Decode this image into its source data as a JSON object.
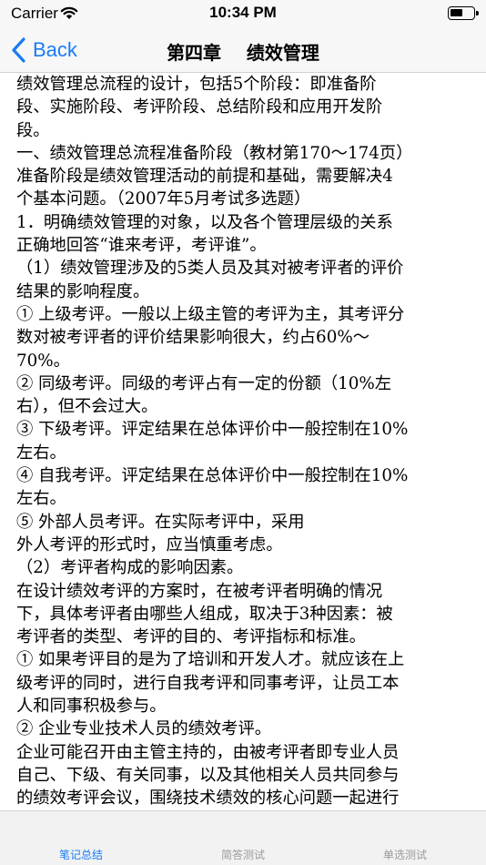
{
  "status_bar": {
    "carrier": "Carrier",
    "time": "10:34 PM"
  },
  "nav": {
    "back_label": "Back",
    "title": "第四章    绩效管理"
  },
  "content": {
    "lines": [
      "绩效管理总流程的设计，包括5个阶段：即准备阶",
      "段、实施阶段、考评阶段、总结阶段和应用开发阶",
      "段。",
      "一、绩效管理总流程准备阶段（教材第170～174页）",
      "准备阶段是绩效管理活动的前提和基础，需要解决4",
      "个基本问题。（2007年5月考试多选题）",
      "1．明确绩效管理的对象，以及各个管理层级的关系",
      "正确地回答“谁来考评，考评谁”。",
      "（1）绩效管理涉及的5类人员及其对被考评者的评价",
      "结果的影响程度。",
      "① 上级考评。一般以上级主管的考评为主，其考评分",
      "数对被考评者的评价结果影响很大，约占60%～",
      "70%。",
      "② 同级考评。同级的考评占有一定的份额（10%左",
      "右），但不会过大。",
      "③ 下级考评。评定结果在总体评价中一般控制在10%",
      "左右。",
      "④ 自我考评。评定结果在总体评价中一般控制在10%",
      "左右。",
      "⑤ 外部人员考评。在实际考评中，采用",
      "外人考评的形式时，应当慎重考虑。",
      "（2）考评者构成的影响因素。",
      "在设计绩效考评的方案时，在被考评者明确的情况",
      "下，具体考评者由哪些人组成，取决于3种因素：被",
      "考评者的类型、考评的目的、考评指标和标准。",
      "① 如果考评目的是为了培训和开发人才。就应该在上",
      "级考评的同时，进行自我考评和同事考评，让员工本",
      "人和同事积极参与。",
      "② 企业专业技术人员的绩效考评。",
      "企业可能召开由主管主持的，由被考评者即专业人员",
      "自己、下级、有关同事，以及其他相关人员共同参与",
      "的绩效考评会议，围绕技术绩效的核心问题一起进行"
    ]
  },
  "tabs": [
    {
      "label": "笔记总结",
      "active": true
    },
    {
      "label": "简答测试",
      "active": false
    },
    {
      "label": "单选测试",
      "active": false
    }
  ],
  "colors": {
    "accent": "#1a7cf5",
    "inactive_tab": "#9a9a9a"
  }
}
